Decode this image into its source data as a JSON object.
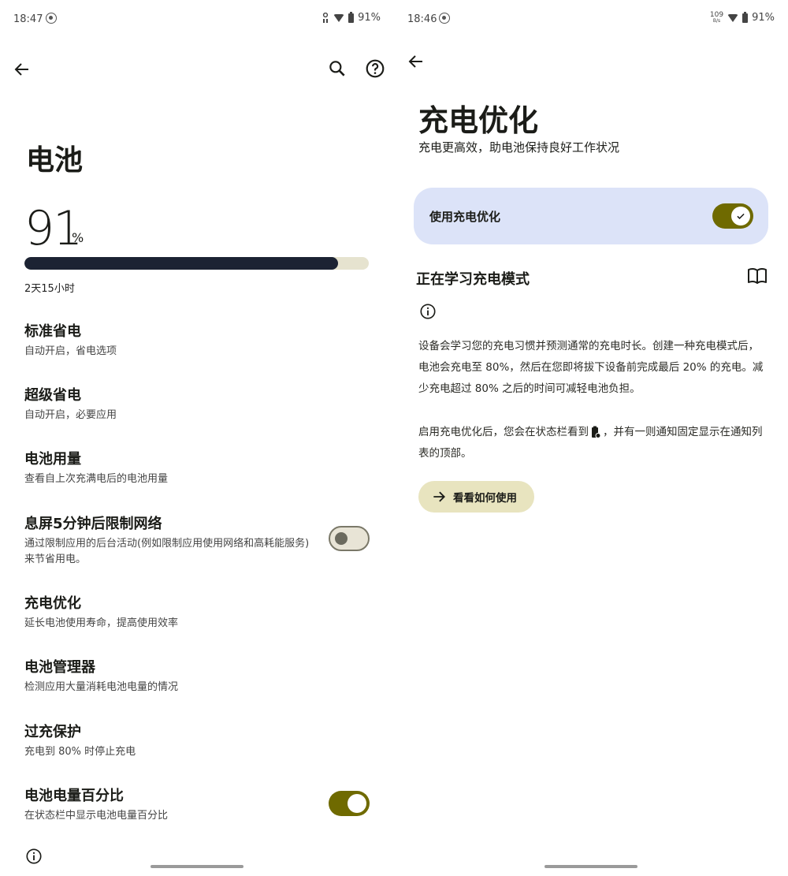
{
  "left": {
    "status": {
      "time": "18:47",
      "battery": "91%"
    },
    "title": "电池",
    "battery_level": "91",
    "battery_unit": "%",
    "battery_fraction": 0.91,
    "remaining": "2天15小时",
    "items": [
      {
        "title": "标准省电",
        "subtitle": "自动开启，省电选项"
      },
      {
        "title": "超级省电",
        "subtitle": "自动开启，必要应用"
      },
      {
        "title": "电池用量",
        "subtitle": "查看自上次充满电后的电池用量"
      },
      {
        "title": "息屏5分钟后限制网络",
        "subtitle": "通过限制应用的后台活动(例如限制应用使用网络和高耗能服务)来节省用电。",
        "toggle": "off"
      },
      {
        "title": "充电优化",
        "subtitle": "延长电池使用寿命，提高使用效率"
      },
      {
        "title": "电池管理器",
        "subtitle": "检测应用大量消耗电池电量的情况"
      },
      {
        "title": "过充保护",
        "subtitle": "充电到 80% 时停止充电"
      },
      {
        "title": "电池电量百分比",
        "subtitle": "在状态栏中显示电池电量百分比",
        "toggle": "on"
      }
    ]
  },
  "right": {
    "status": {
      "time": "18:46",
      "net_top": "109",
      "net_bottom": "B/s",
      "battery": "91%"
    },
    "title": "充电优化",
    "subtitle": "充电更高效，助电池保持良好工作状况",
    "card_label": "使用充电优化",
    "card_toggle": "on",
    "section_title": "正在学习充电模式",
    "para1": "设备会学习您的充电习惯并预测通常的充电时长。创建一种充电模式后，电池会充电至 80%，然后在您即将拔下设备前完成最后 20% 的充电。减少充电超过 80% 之后的时间可减轻电池负担。",
    "para2_before": "启用充电优化后，您会在状态栏看到",
    "para2_after": "，并有一则通知固定显示在通知列表的顶部。",
    "howto_label": "看看如何使用"
  },
  "colors": {
    "accent": "#6f6a00",
    "bar": "#1c2333",
    "card": "#dce3f8",
    "chip": "#e8e4bf"
  }
}
